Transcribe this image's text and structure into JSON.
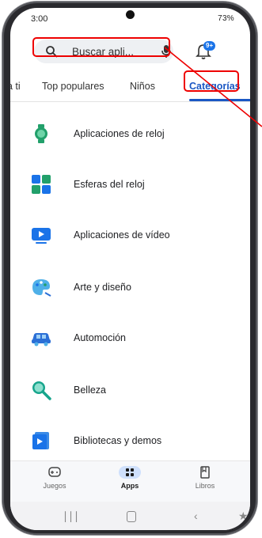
{
  "status_bar": {
    "time": "3:00",
    "battery": "73%"
  },
  "search": {
    "placeholder": "Buscar apli...",
    "icon": "search-icon",
    "mic_icon": "mic-icon"
  },
  "notifications": {
    "badge": "9+"
  },
  "tabs": [
    {
      "label": "a ti"
    },
    {
      "label": "Top populares"
    },
    {
      "label": "Niños"
    },
    {
      "label": "Categorías",
      "active": true
    }
  ],
  "categories": [
    {
      "label": "Aplicaciones de reloj",
      "icon": "watch-icon",
      "color": "#22a06b"
    },
    {
      "label": "Esferas del reloj",
      "icon": "watch-faces-icon",
      "color": "#1a73e8"
    },
    {
      "label": "Aplicaciones de vídeo",
      "icon": "video-icon",
      "color": "#1a73e8"
    },
    {
      "label": "Arte y diseño",
      "icon": "palette-icon",
      "color": "#4fb0e8"
    },
    {
      "label": "Automoción",
      "icon": "car-icon",
      "color": "#2b6fd6"
    },
    {
      "label": "Belleza",
      "icon": "mirror-icon",
      "color": "#17a58c"
    },
    {
      "label": "Bibliotecas y demos",
      "icon": "library-icon",
      "color": "#3b8be6"
    }
  ],
  "bottom_nav": [
    {
      "label": "Juegos",
      "icon": "gamepad-icon"
    },
    {
      "label": "Apps",
      "icon": "apps-grid-icon",
      "active": true
    },
    {
      "label": "Libros",
      "icon": "book-icon"
    }
  ],
  "annotation_color": "#ee0000"
}
